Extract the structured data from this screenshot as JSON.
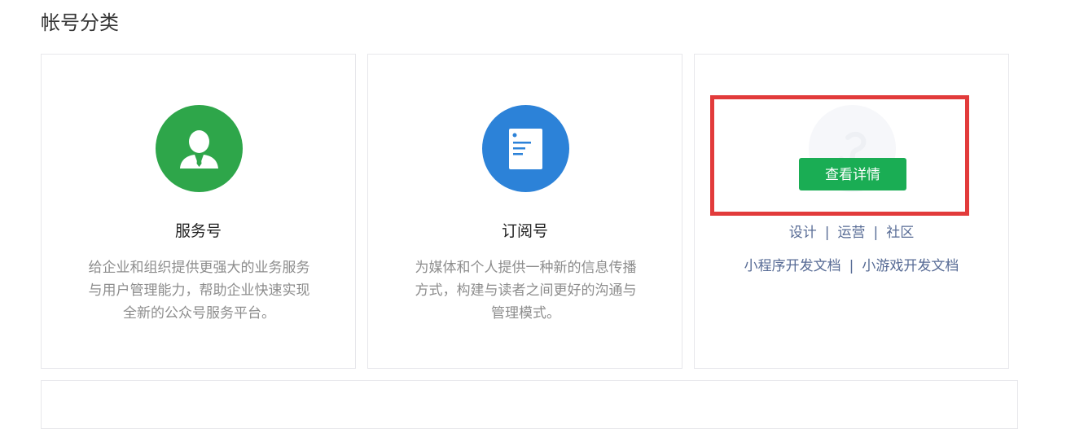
{
  "section": {
    "title": "帐号分类"
  },
  "cards": [
    {
      "name": "服务号",
      "description": "给企业和组织提供更强大的业务服务与用户管理能力，帮助企业快速实现全新的公众号服务平台。",
      "icon": "person-icon",
      "icon_color": "#2ea64a"
    },
    {
      "name": "订阅号",
      "description": "为媒体和个人提供一种新的信息传播方式，构建与读者之间更好的沟通与管理模式。",
      "icon": "document-icon",
      "icon_color": "#2c82d8"
    },
    {
      "icon": "miniprogram-icon",
      "button_label": "查看详情",
      "links_row1": [
        "设计",
        "运营",
        "社区"
      ],
      "links_row2": [
        "小程序开发文档",
        "小游戏开发文档"
      ],
      "separator": "|"
    }
  ],
  "colors": {
    "accent_green": "#1aad54",
    "link": "#576b95",
    "highlight": "#e23b3b"
  }
}
